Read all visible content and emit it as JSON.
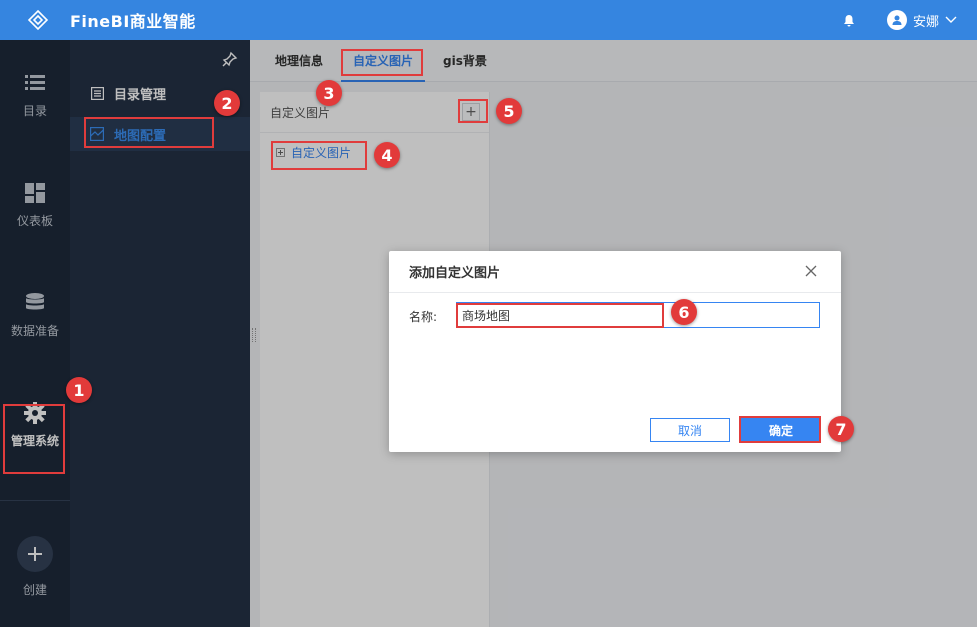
{
  "app": {
    "title": "FineBI商业智能",
    "user": "安娜"
  },
  "rail": {
    "items": [
      {
        "label": "目录",
        "icon": "list-icon"
      },
      {
        "label": "仪表板",
        "icon": "dashboard-icon"
      },
      {
        "label": "数据准备",
        "icon": "database-icon"
      },
      {
        "label": "管理系统",
        "icon": "gear-icon"
      }
    ],
    "create_label": "创建"
  },
  "subnav": {
    "items": [
      {
        "label": "目录管理",
        "icon": "catalog-icon"
      },
      {
        "label": "地图配置",
        "icon": "map-icon"
      }
    ]
  },
  "tabs": [
    {
      "label": "地理信息"
    },
    {
      "label": "自定义图片"
    },
    {
      "label": "gis背景"
    }
  ],
  "panel": {
    "title": "自定义图片",
    "add_label": "+",
    "tree_item": "自定义图片"
  },
  "dialog": {
    "title": "添加自定义图片",
    "field_label": "名称:",
    "name_value": "商场地图",
    "cancel_label": "取消",
    "ok_label": "确定"
  },
  "steps": [
    "1",
    "2",
    "3",
    "4",
    "5",
    "6",
    "7"
  ],
  "colors": {
    "accent": "#3685f2",
    "topbar": "#3585e0",
    "rail": "#1e2a3b",
    "annotation": "#e23a3a"
  }
}
